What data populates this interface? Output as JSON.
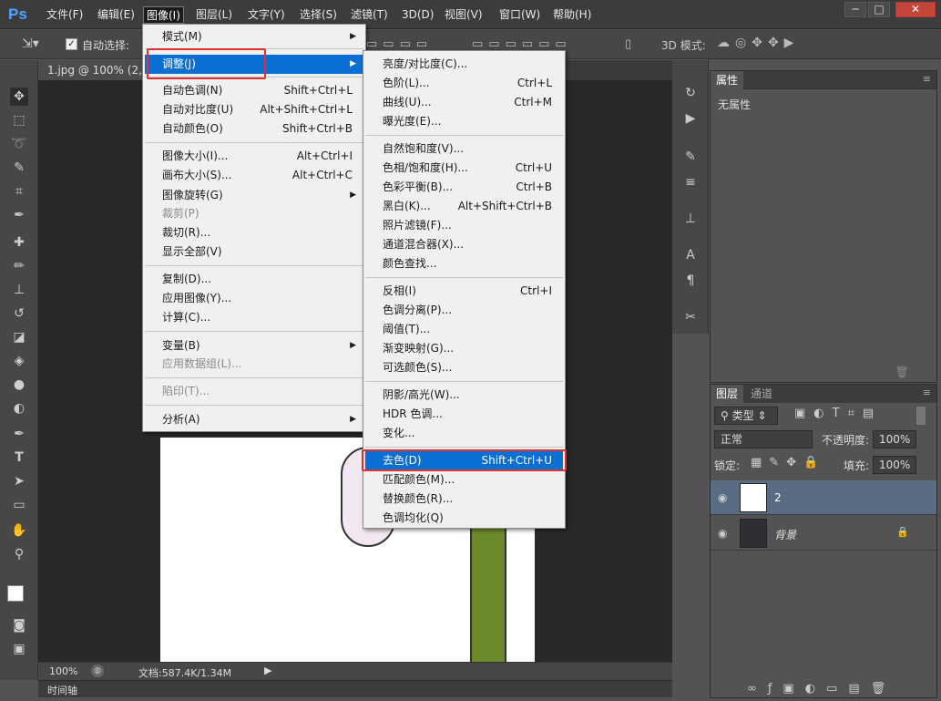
{
  "app": {
    "logo": "Ps",
    "title_menus": [
      "文件(F)",
      "编辑(E)",
      "图像(I)",
      "图层(L)",
      "文字(Y)",
      "选择(S)",
      "滤镜(T)",
      "3D(D)",
      "视图(V)",
      "窗口(W)",
      "帮助(H)"
    ]
  },
  "window_controls": {
    "minimize": "─",
    "maximize": "□",
    "close": "✕"
  },
  "options_bar": {
    "auto_select_label": "自动选择:",
    "mode_3d_label": "3D 模式:"
  },
  "document": {
    "tab_title": "1.jpg @ 100% (2, R",
    "zoom": "100%",
    "doc_info": "文档:587.4K/1.34M"
  },
  "timeline": {
    "label": "时间轴"
  },
  "image_menu": {
    "items": [
      {
        "label": "模式(M)",
        "shortcut": "",
        "submenu": true
      },
      {
        "label": "调整(J)",
        "shortcut": "",
        "submenu": true,
        "selected": true
      },
      {
        "label": "自动色调(N)",
        "shortcut": "Shift+Ctrl+L"
      },
      {
        "label": "自动对比度(U)",
        "shortcut": "Alt+Shift+Ctrl+L"
      },
      {
        "label": "自动颜色(O)",
        "shortcut": "Shift+Ctrl+B"
      },
      {
        "label": "图像大小(I)...",
        "shortcut": "Alt+Ctrl+I"
      },
      {
        "label": "画布大小(S)...",
        "shortcut": "Alt+Ctrl+C"
      },
      {
        "label": "图像旋转(G)",
        "shortcut": "",
        "submenu": true
      },
      {
        "label": "裁剪(P)",
        "shortcut": "",
        "disabled": true
      },
      {
        "label": "裁切(R)...",
        "shortcut": ""
      },
      {
        "label": "显示全部(V)",
        "shortcut": ""
      },
      {
        "label": "复制(D)...",
        "shortcut": ""
      },
      {
        "label": "应用图像(Y)...",
        "shortcut": ""
      },
      {
        "label": "计算(C)...",
        "shortcut": ""
      },
      {
        "label": "变量(B)",
        "shortcut": "",
        "submenu": true
      },
      {
        "label": "应用数据组(L)...",
        "shortcut": "",
        "disabled": true
      },
      {
        "label": "陷印(T)...",
        "shortcut": "",
        "disabled": true
      },
      {
        "label": "分析(A)",
        "shortcut": "",
        "submenu": true
      }
    ]
  },
  "adjust_menu": {
    "items": [
      {
        "label": "亮度/对比度(C)...",
        "shortcut": ""
      },
      {
        "label": "色阶(L)...",
        "shortcut": "Ctrl+L"
      },
      {
        "label": "曲线(U)...",
        "shortcut": "Ctrl+M"
      },
      {
        "label": "曝光度(E)...",
        "shortcut": ""
      },
      {
        "label": "自然饱和度(V)...",
        "shortcut": ""
      },
      {
        "label": "色相/饱和度(H)...",
        "shortcut": "Ctrl+U"
      },
      {
        "label": "色彩平衡(B)...",
        "shortcut": "Ctrl+B"
      },
      {
        "label": "黑白(K)...",
        "shortcut": "Alt+Shift+Ctrl+B"
      },
      {
        "label": "照片滤镜(F)...",
        "shortcut": ""
      },
      {
        "label": "通道混合器(X)...",
        "shortcut": ""
      },
      {
        "label": "颜色查找...",
        "shortcut": ""
      },
      {
        "label": "反相(I)",
        "shortcut": "Ctrl+I"
      },
      {
        "label": "色调分离(P)...",
        "shortcut": ""
      },
      {
        "label": "阈值(T)...",
        "shortcut": ""
      },
      {
        "label": "渐变映射(G)...",
        "shortcut": ""
      },
      {
        "label": "可选颜色(S)...",
        "shortcut": ""
      },
      {
        "label": "阴影/高光(W)...",
        "shortcut": ""
      },
      {
        "label": "HDR 色调...",
        "shortcut": ""
      },
      {
        "label": "变化...",
        "shortcut": ""
      },
      {
        "label": "去色(D)",
        "shortcut": "Shift+Ctrl+U",
        "selected": true
      },
      {
        "label": "匹配颜色(M)...",
        "shortcut": ""
      },
      {
        "label": "替换颜色(R)...",
        "shortcut": ""
      },
      {
        "label": "色调均化(Q)",
        "shortcut": ""
      }
    ]
  },
  "properties_panel": {
    "title": "属性",
    "empty_text": "无属性"
  },
  "layers_panel": {
    "tab_layers": "图层",
    "tab_channels": "通道",
    "filter_label": "类型",
    "blend_mode": "正常",
    "opacity_label": "不透明度:",
    "opacity_value": "100%",
    "lock_label": "锁定:",
    "fill_label": "填充:",
    "fill_value": "100%",
    "layers": [
      {
        "name": "2",
        "selected": true
      },
      {
        "name": "背景",
        "locked": true
      }
    ]
  },
  "colors": {
    "selection_blue": "#0a6fd3",
    "highlight_red": "#e03030",
    "ps_blue": "#4fa3ff"
  },
  "icons": [
    "move-tool-icon",
    "marquee-icon",
    "lasso-icon",
    "quick-select-icon",
    "crop-icon",
    "eyedropper-icon",
    "healing-icon",
    "brush-icon",
    "stamp-icon",
    "history-brush-icon",
    "eraser-icon",
    "bucket-icon",
    "blur-icon",
    "dodge-icon",
    "pen-icon",
    "type-icon",
    "path-select-icon",
    "shape-icon",
    "hand-icon",
    "zoom-icon"
  ]
}
